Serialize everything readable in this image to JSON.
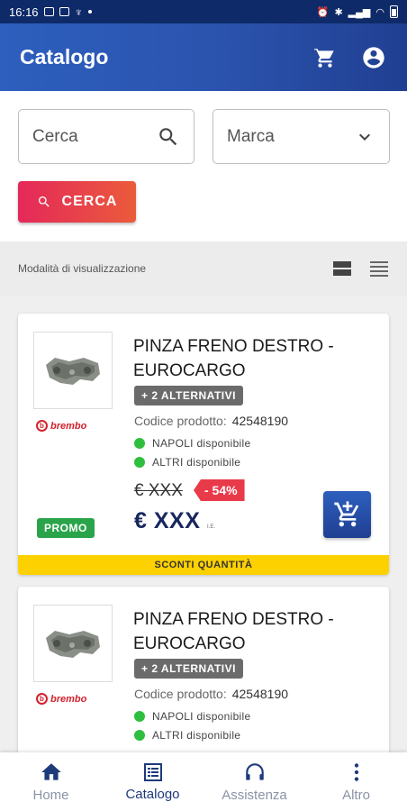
{
  "status_bar": {
    "time": "16:16"
  },
  "app_bar": {
    "title": "Catalogo"
  },
  "search": {
    "search_placeholder": "Cerca",
    "brand_placeholder": "Marca",
    "button_label": "CERCA"
  },
  "view_mode": {
    "label": "Modalità di visualizzazione"
  },
  "products": [
    {
      "title": "PINZA FRENO DESTRO - EUROCARGO",
      "alternatives": "+ 2 ALTERNATIVI",
      "code_label": "Codice prodotto:",
      "code_value": "42548190",
      "brand": "brembo",
      "availability": [
        "NAPOLI disponibile",
        "ALTRI disponibile"
      ],
      "old_price": "€ XXX",
      "discount": "- 54%",
      "price": "€ XXX",
      "price_note": "I.E.",
      "promo": "PROMO",
      "banner": "SCONTI QUANTITÀ"
    },
    {
      "title": "PINZA FRENO DESTRO - EUROCARGO",
      "alternatives": "+ 2 ALTERNATIVI",
      "code_label": "Codice prodotto:",
      "code_value": "42548190",
      "brand": "brembo",
      "availability": [
        "NAPOLI disponibile",
        "ALTRI disponibile"
      ]
    }
  ],
  "bottom_nav": [
    {
      "label": "Home",
      "icon": "home-icon"
    },
    {
      "label": "Catalogo",
      "icon": "catalog-icon",
      "active": true
    },
    {
      "label": "Assistenza",
      "icon": "headset-icon"
    },
    {
      "label": "Altro",
      "icon": "more-vert-icon"
    }
  ],
  "colors": {
    "primary": "#2b53ad",
    "accent": "#e5285a",
    "available": "#2fbf3e",
    "promo": "#2aa44a",
    "banner": "#fdd100",
    "discount": "#e93a4a"
  }
}
